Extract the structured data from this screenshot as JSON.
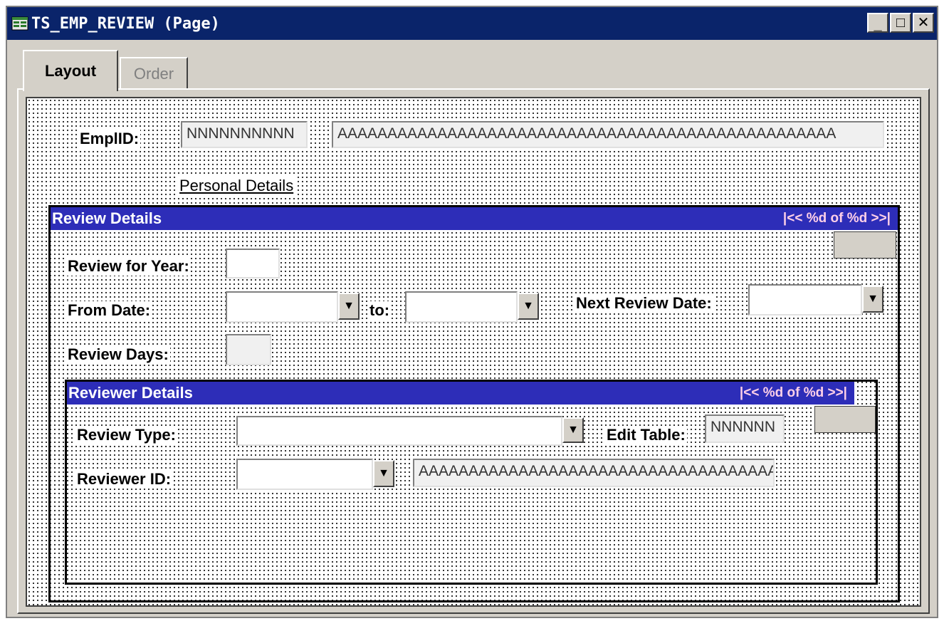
{
  "window": {
    "title": "TS_EMP_REVIEW (Page)",
    "minimize_label": "_",
    "maximize_label": "□",
    "close_label": "✕"
  },
  "tabs": [
    {
      "label": "Layout",
      "active": true
    },
    {
      "label": "Order",
      "active": false
    }
  ],
  "header_fields": {
    "emplid_label": "EmplID:",
    "emplid_value": "NNNNNNNNNN",
    "name_value": "AAAAAAAAAAAAAAAAAAAAAAAAAAAAAAAAAAAAAAAAAAAAAAAAAA"
  },
  "personal_details_link": "Personal Details",
  "review_details": {
    "title": "Review Details",
    "nav": "|<< %d of %d >>|",
    "review_year_label": "Review for Year:",
    "from_date_label": "From Date:",
    "to_label": "to:",
    "next_review_label": "Next Review Date:",
    "review_days_label": "Review Days:"
  },
  "reviewer_details": {
    "title": "Reviewer Details",
    "nav": "|<< %d of %d >>|",
    "review_type_label": "Review Type:",
    "edit_table_label": "Edit Table:",
    "edit_table_value": "NNNNNN",
    "reviewer_id_label": "Reviewer ID:",
    "reviewer_name_value": "AAAAAAAAAAAAAAAAAAAAAAAAAAAAAAAAAAAAAA"
  },
  "dropdown_glyph": "▼",
  "icons": {
    "title_icon": "page-icon",
    "dropdown_icon": "arrow-down-icon"
  },
  "colors": {
    "titlebar": "#0a246a",
    "scroll_header": "#2d2db8",
    "scroll_nav": "#ffd0e8"
  }
}
